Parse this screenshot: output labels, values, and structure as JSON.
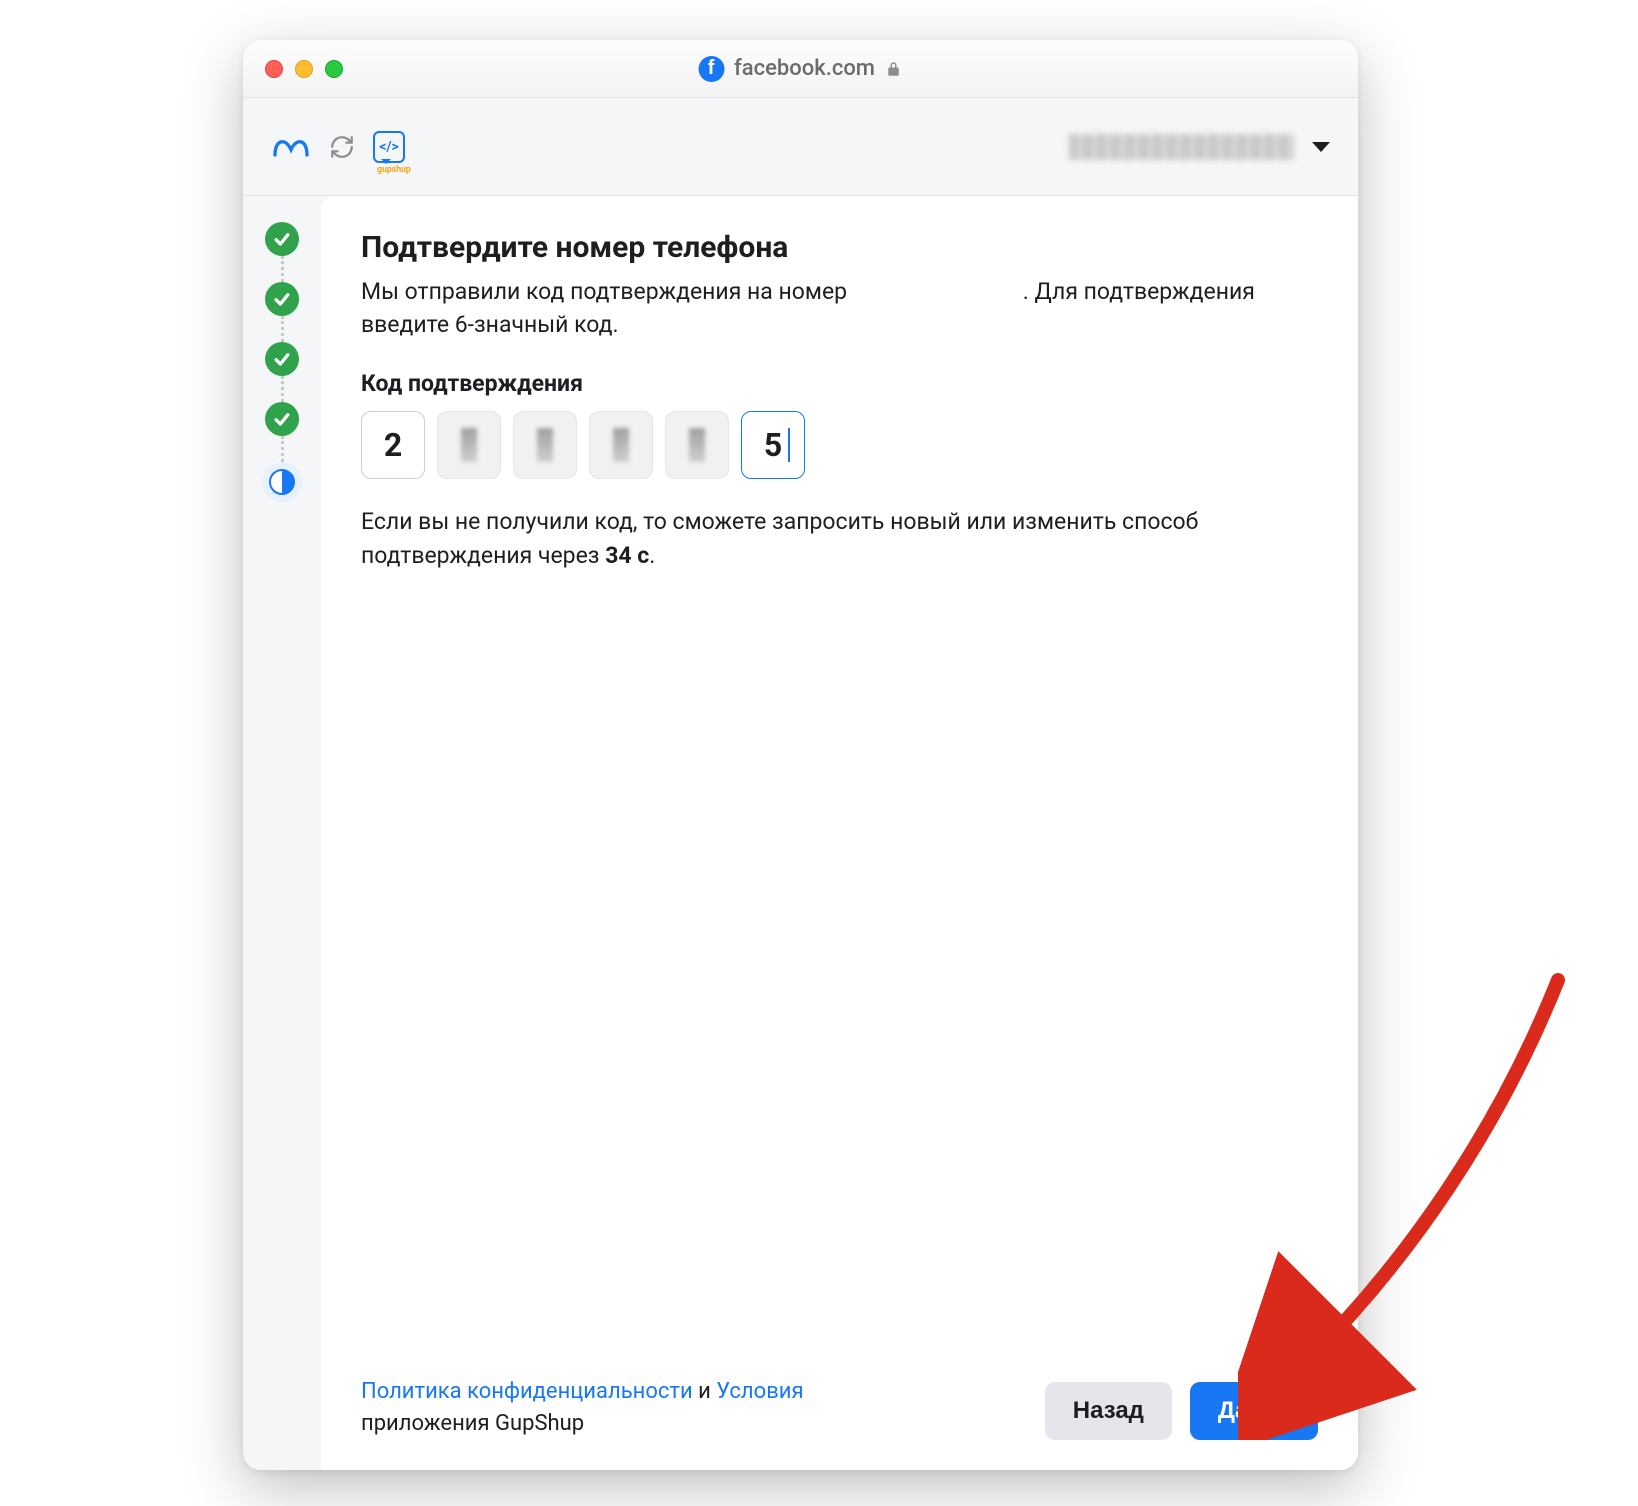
{
  "titlebar": {
    "domain": "facebook.com"
  },
  "header": {
    "gupshup_tag": "</>"
  },
  "main": {
    "heading": "Подтвердите номер телефона",
    "description_prefix": "Мы отправили код подтверждения на номер ",
    "description_suffix": ". Для подтверждения введите 6-значный код.",
    "code_label": "Код подтверждения",
    "code_digits": [
      "2",
      "",
      "",
      "",
      "",
      "5"
    ],
    "hint_prefix": "Если вы не получили код, то сможете запросить новый или изменить способ подтверждения через ",
    "hint_countdown": "34 с",
    "hint_suffix": "."
  },
  "footer": {
    "privacy_link": "Политика конфиденциальности",
    "connector": " и ",
    "terms_link": "Условия",
    "app_suffix": " приложения GupShup",
    "back_label": "Назад",
    "next_label": "Далее"
  }
}
